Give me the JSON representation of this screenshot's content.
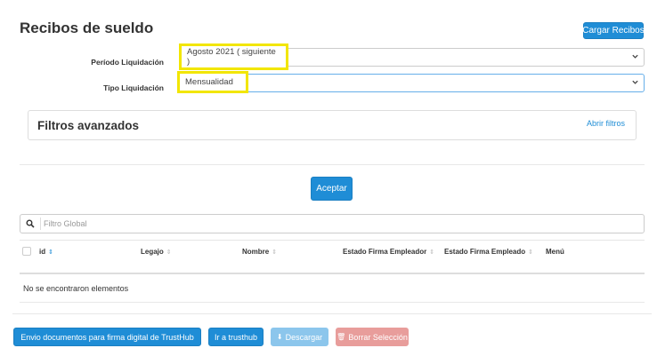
{
  "page": {
    "title": "Recibos de sueldo",
    "cargar_button": "Cargar Recibos"
  },
  "form": {
    "periodo_label": "Período Liquidación",
    "periodo_value": "Agosto 2021 ( siguiente )",
    "tipo_label": "Tipo Liquidación",
    "tipo_value": "Mensualidad"
  },
  "filters": {
    "title": "Filtros avanzados",
    "open_link": "Abrir filtros"
  },
  "aceptar_button": "Aceptar",
  "search": {
    "placeholder": "Filtro Global"
  },
  "table": {
    "columns": [
      "id",
      "Legajo",
      "Nombre",
      "Estado Firma Empleador",
      "Estado Firma Empleado",
      "Menú"
    ],
    "empty_message": "No se encontraron elementos"
  },
  "actions": {
    "envio": "Envio documentos para firma digital de TrustHub",
    "ir": "Ir a trusthub",
    "descargar": "Descargar",
    "borrar": "Borrar Selección"
  },
  "colors": {
    "primary": "#1f8dd6",
    "highlight": "#f2e600",
    "disabled_primary": "#8cc6ec",
    "disabled_danger": "#e89d9b"
  }
}
